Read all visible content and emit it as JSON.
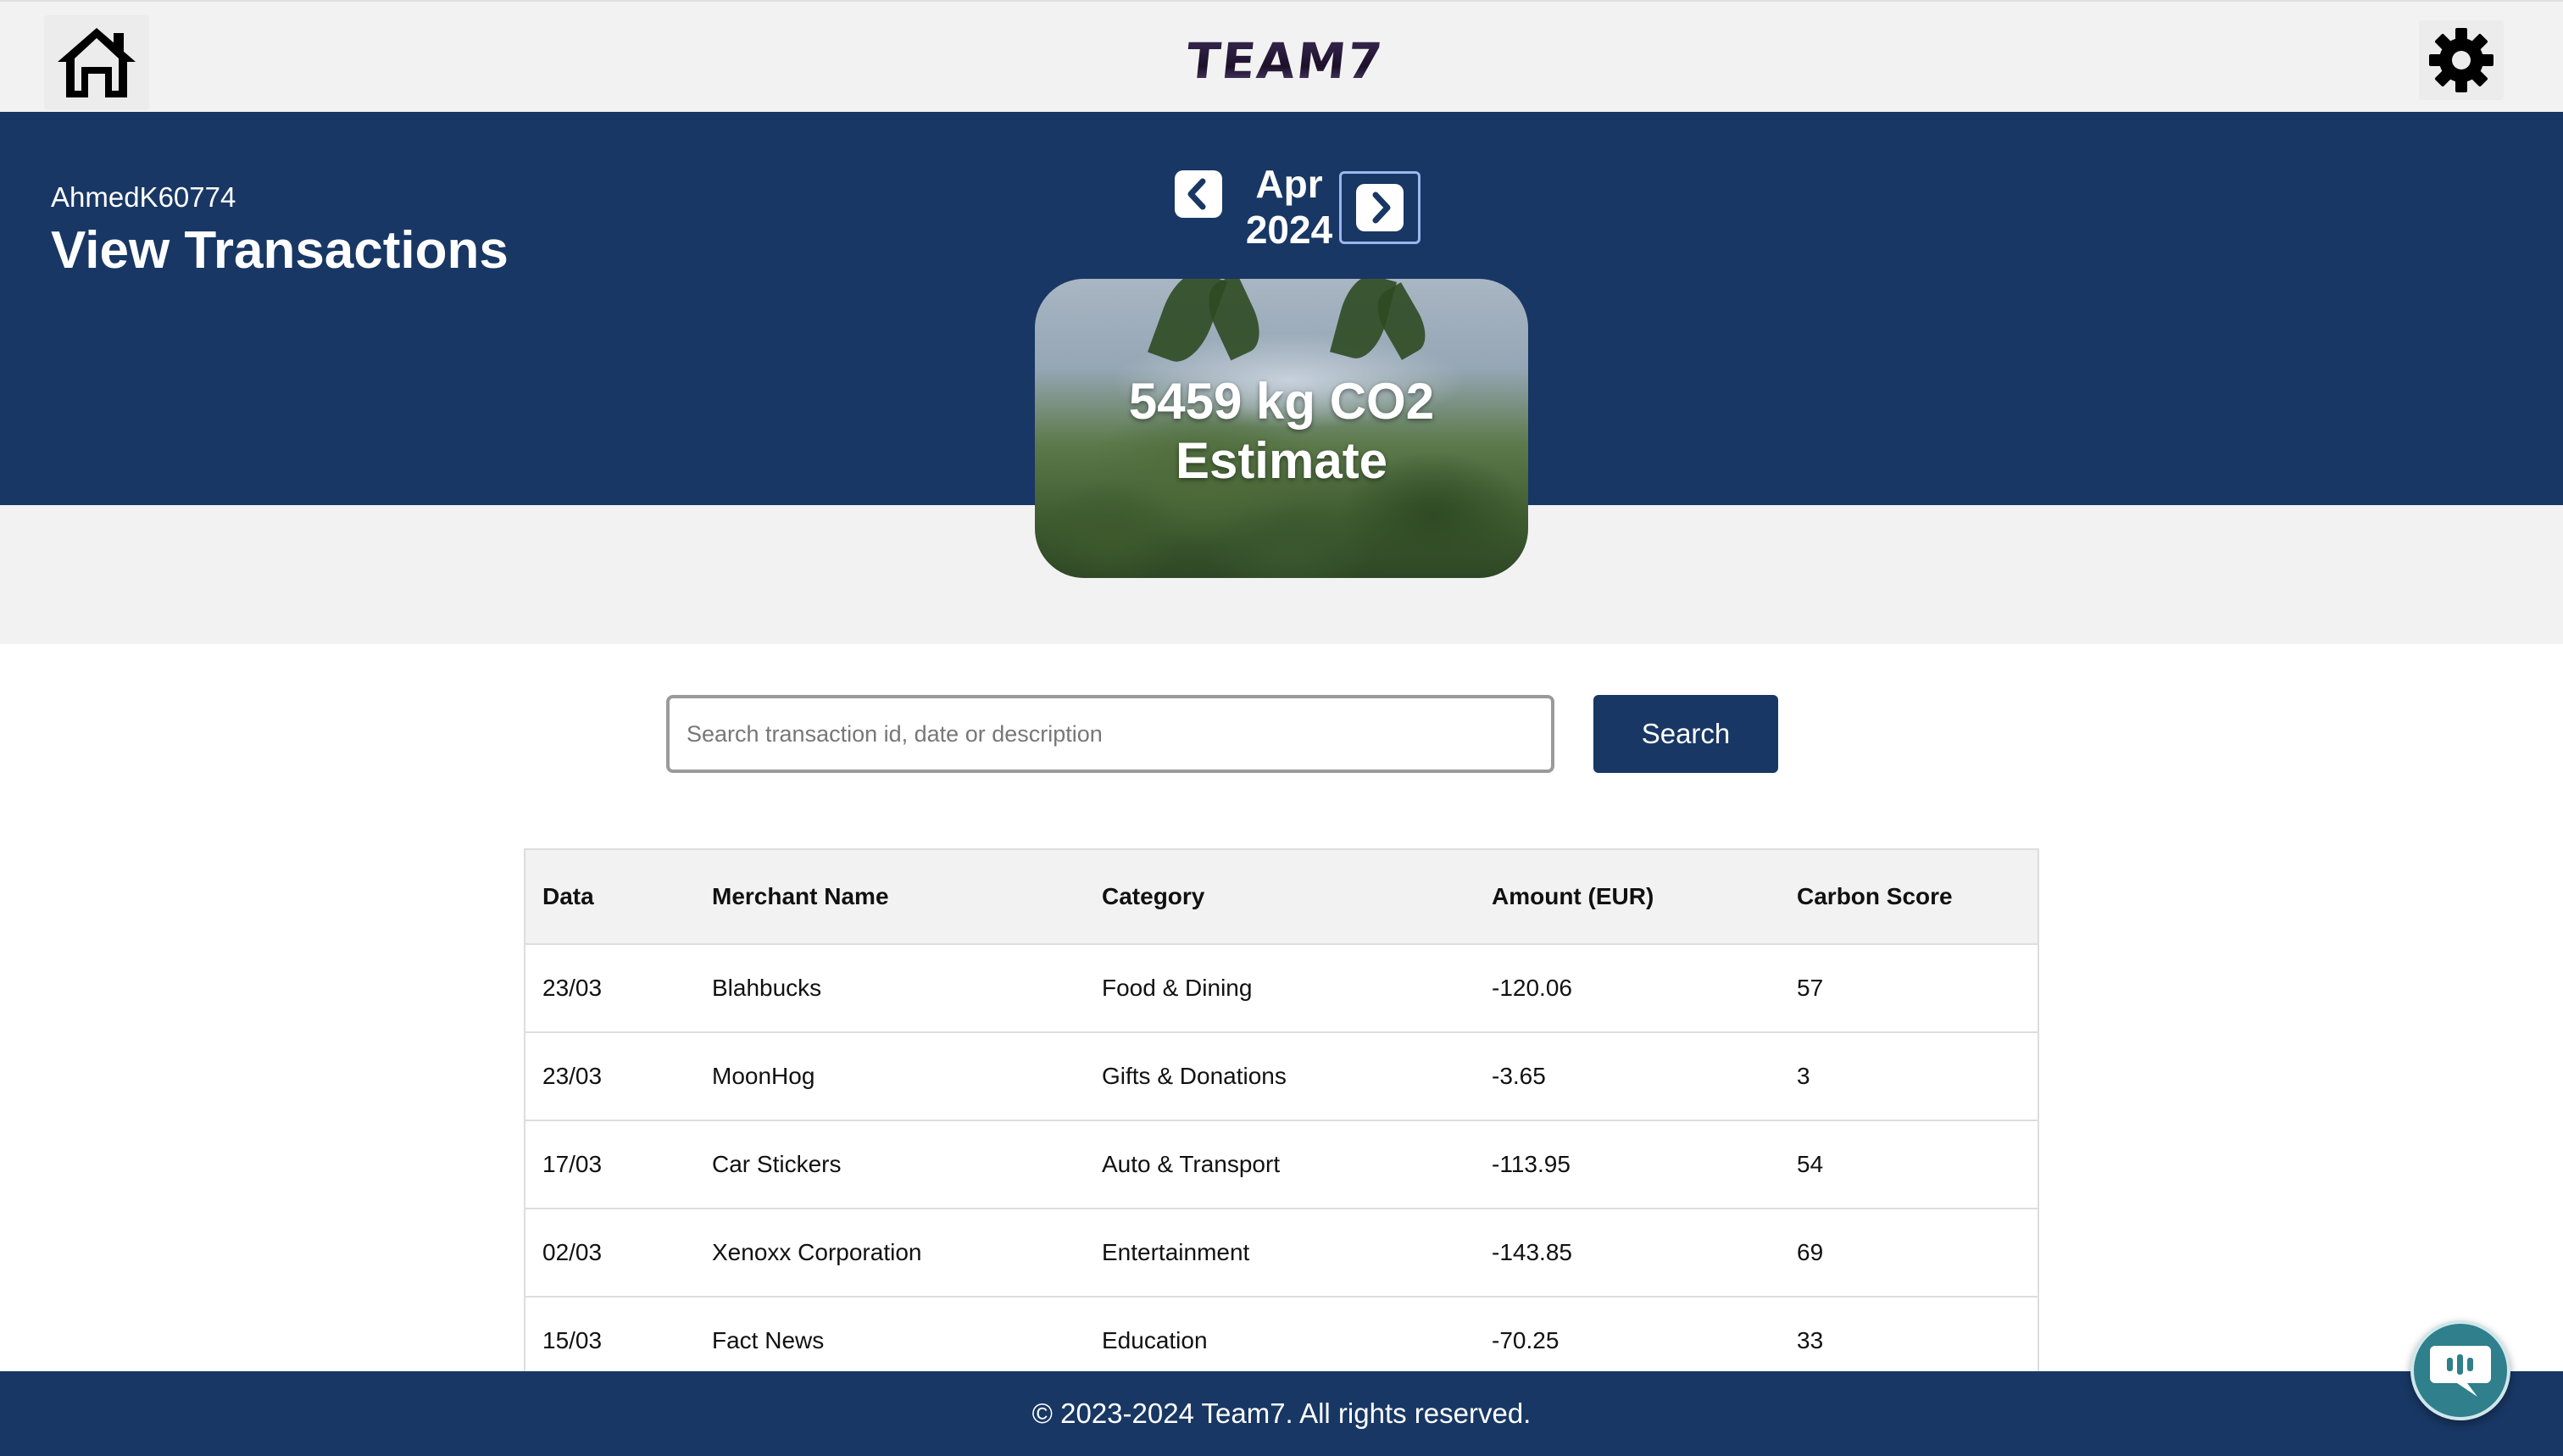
{
  "brand": {
    "logo_text": "TEAM7"
  },
  "user": {
    "username": "AhmedK60774"
  },
  "page": {
    "title": "View Transactions"
  },
  "period": {
    "month": "Apr",
    "year": "2024"
  },
  "carbon": {
    "line1": "5459 kg CO2",
    "line2": "Estimate"
  },
  "search": {
    "placeholder": "Search transaction id, date or description",
    "button_label": "Search"
  },
  "table": {
    "headers": [
      "Data",
      "Merchant Name",
      "Category",
      "Amount (EUR)",
      "Carbon Score"
    ],
    "rows": [
      [
        "23/03",
        "Blahbucks",
        "Food & Dining",
        "-120.06",
        "57"
      ],
      [
        "23/03",
        "MoonHog",
        "Gifts & Donations",
        "-3.65",
        "3"
      ],
      [
        "17/03",
        "Car Stickers",
        "Auto & Transport",
        "-113.95",
        "54"
      ],
      [
        "02/03",
        "Xenoxx Corporation",
        "Entertainment",
        "-143.85",
        "69"
      ],
      [
        "15/03",
        "Fact News",
        "Education",
        "-70.25",
        "33"
      ]
    ]
  },
  "footer": {
    "text": "© 2023-2024 Team7. All rights reserved."
  },
  "icons": {
    "home": "home-icon",
    "settings": "gear-icon",
    "prev": "chevron-left-icon",
    "next": "chevron-right-icon",
    "chat": "chat-icon"
  },
  "colors": {
    "brand_navy": "#183764",
    "chat_teal": "#2f7f8c",
    "page_grey": "#f2f2f2"
  }
}
